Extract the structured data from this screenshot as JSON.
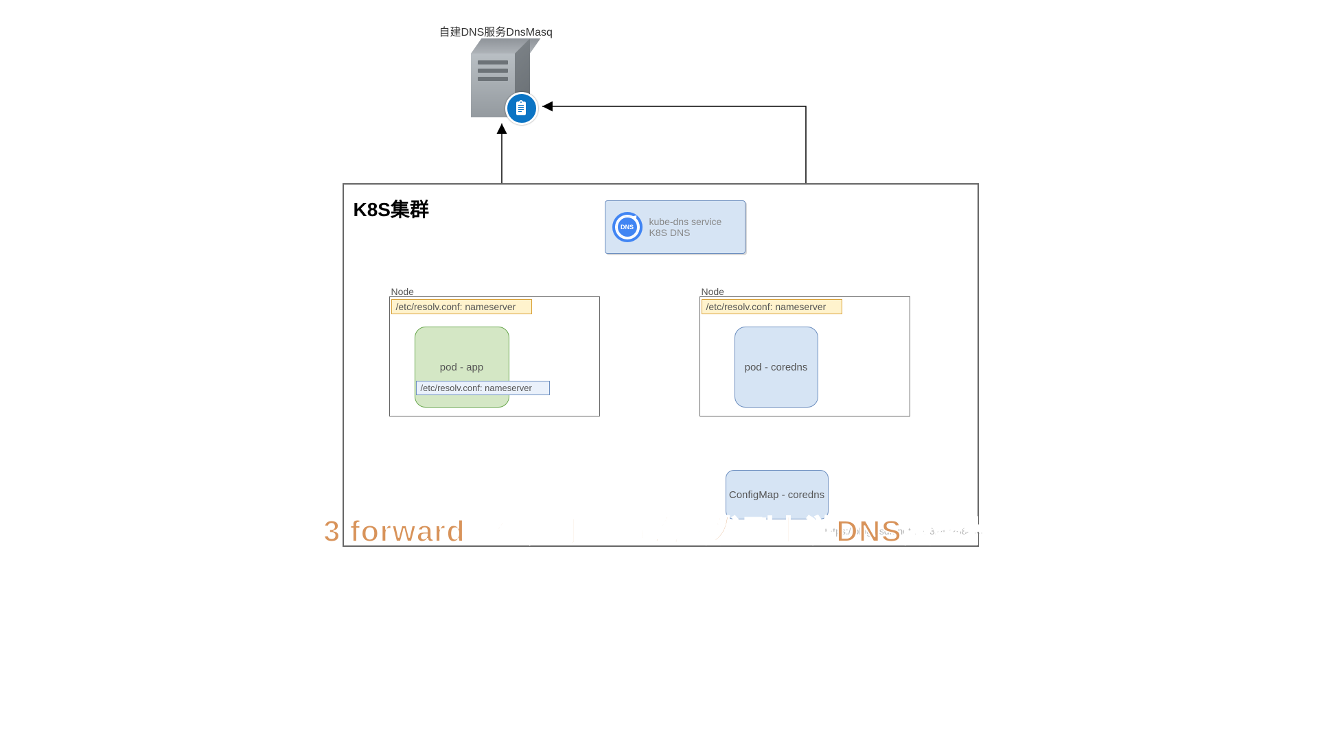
{
  "top_label": "自建DNS服务DnsMasq",
  "cluster_title": "K8S集群",
  "node_label": "Node",
  "nameserver_label": "/etc/resolv.conf: nameserver",
  "pod_app": "pod - app",
  "pod_resolv": "/etc/resolv.conf: nameserver",
  "kube_dns_line1": "kube-dns service",
  "kube_dns_line2": "K8S DNS",
  "pod_coredns": "pod -  coredns",
  "configmap": "ConfigMap - coredns",
  "caption": "3 forward插件用于将查询转发到上游DNS服务器",
  "watermark": "https://blog.csdn.net/u013242268810"
}
